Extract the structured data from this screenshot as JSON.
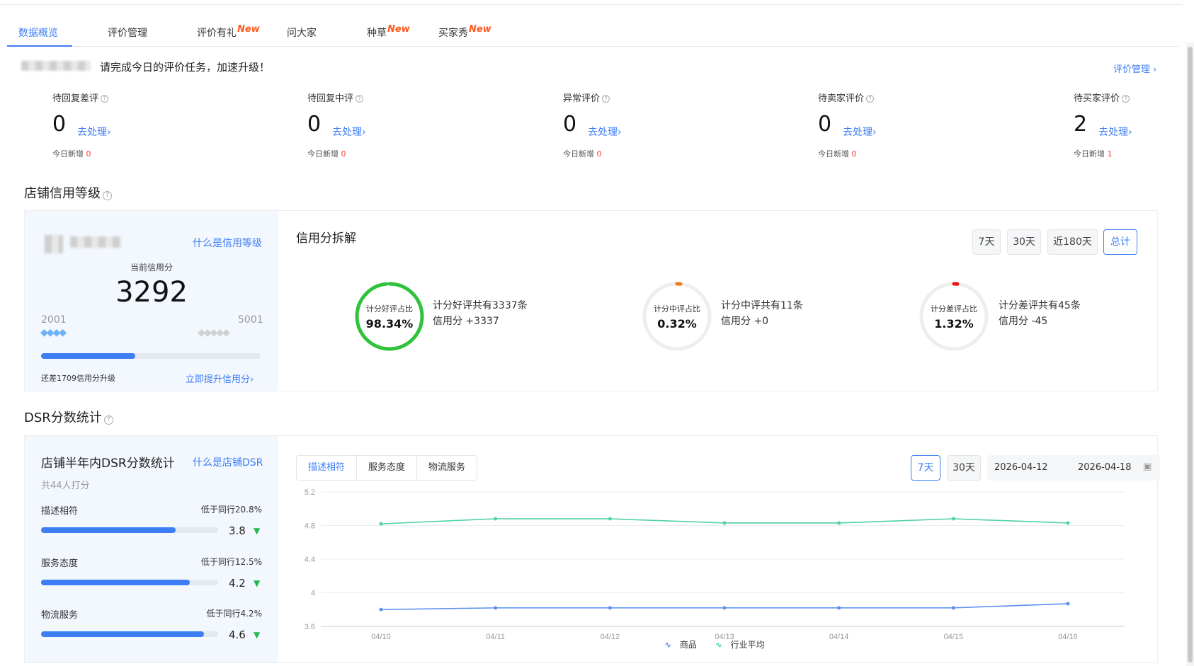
{
  "tabs": [
    {
      "label": "数据概览",
      "badge": ""
    },
    {
      "label": "评价管理",
      "badge": ""
    },
    {
      "label": "评价有礼",
      "badge": "New"
    },
    {
      "label": "问大家",
      "badge": ""
    },
    {
      "label": "种草",
      "badge": "New"
    },
    {
      "label": "买家秀",
      "badge": "New"
    }
  ],
  "banner": {
    "task_text": "请完成今日的评价任务，加速升级！",
    "review_mgmt_link": "评价管理 ›"
  },
  "stats": [
    {
      "label": "待回复差评",
      "value": "0",
      "action": "去处理›",
      "new_label": "今日新增",
      "new_count": "0"
    },
    {
      "label": "待回复中评",
      "value": "0",
      "action": "去处理›",
      "new_label": "今日新增",
      "new_count": "0"
    },
    {
      "label": "异常评价",
      "value": "0",
      "action": "去处理›",
      "new_label": "今日新增",
      "new_count": "0"
    },
    {
      "label": "待卖家评价",
      "value": "0",
      "action": "去处理›",
      "new_label": "今日新增",
      "new_count": "0"
    },
    {
      "label": "待买家评价",
      "value": "2",
      "action": "去处理›",
      "new_label": "今日新增",
      "new_count": "1"
    }
  ],
  "credit": {
    "section_title": "店铺信用等级",
    "what_is_link": "什么是信用等级",
    "current_label": "当前信用分",
    "current_score": "3292",
    "range_min": "2001",
    "range_max": "5001",
    "progress_fraction": 0.43,
    "upgrade_text": "还差1709信用分升级",
    "boost_link": "立即提升信用分›",
    "breakdown_title": "信用分拆解",
    "periods": [
      "7天",
      "30天",
      "近180天",
      "总计"
    ],
    "active_period": "总计",
    "rings": [
      {
        "label": "计分好评占比",
        "value": "98.34%",
        "fraction": 0.9834,
        "color": "#2fc23a",
        "line1": "计分好评共有3337条",
        "line2": "信用分 +3337"
      },
      {
        "label": "计分中评占比",
        "value": "0.32%",
        "fraction": 0.0032,
        "color": "#f07a1a",
        "line1": "计分中评共有11条",
        "line2": "信用分 +0"
      },
      {
        "label": "计分差评占比",
        "value": "1.32%",
        "fraction": 0.0132,
        "color": "#ee1111",
        "line1": "计分差评共有45条",
        "line2": "信用分 -45"
      }
    ]
  },
  "dsr": {
    "section_title": "DSR分数统计",
    "card_title": "店铺半年内DSR分数统计",
    "what_is_link": "什么是店铺DSR",
    "raters": "共44人打分",
    "items": [
      {
        "name": "描述相符",
        "compare": "低于同行20.8%",
        "score": "3.8",
        "fraction": 0.76
      },
      {
        "name": "服务态度",
        "compare": "低于同行12.5%",
        "score": "4.2",
        "fraction": 0.84
      },
      {
        "name": "物流服务",
        "compare": "低于同行4.2%",
        "score": "4.6",
        "fraction": 0.92
      }
    ],
    "metric_tabs": [
      "描述相符",
      "服务态度",
      "物流服务"
    ],
    "active_metric": "描述相符",
    "periods": [
      "7天",
      "30天"
    ],
    "active_period": "7天",
    "date_start": "2026-04-12",
    "date_end": "2026-04-18"
  },
  "chart_data": {
    "type": "line",
    "x": [
      "04/10",
      "04/11",
      "04/12",
      "04/13",
      "04/14",
      "04/15",
      "04/16"
    ],
    "y_ticks": [
      "5.2",
      "4.8",
      "4.4",
      "4",
      "3.6"
    ],
    "ylim": [
      3.6,
      5.2
    ],
    "series": [
      {
        "name": "商品",
        "color": "#5b8ff0",
        "values": [
          3.8,
          3.82,
          3.82,
          3.82,
          3.82,
          3.82,
          3.87
        ]
      },
      {
        "name": "行业平均",
        "color": "#4fd1a5",
        "values": [
          4.82,
          4.88,
          4.88,
          4.83,
          4.83,
          4.88,
          4.83
        ]
      }
    ],
    "legend": "bottom",
    "grid": true
  }
}
